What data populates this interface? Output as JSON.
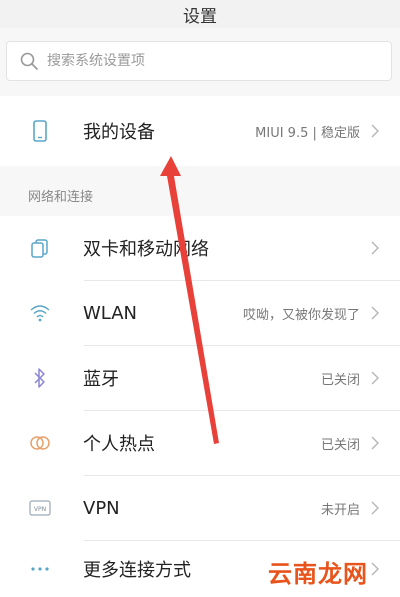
{
  "header": {
    "title": "设置"
  },
  "search": {
    "placeholder": "搜索系统设置项"
  },
  "device_row": {
    "label": "我的设备",
    "value": "MIUI 9.5 | 稳定版",
    "icon": "phone-icon"
  },
  "section": {
    "title": "网络和连接"
  },
  "network_rows": [
    {
      "label": "双卡和移动网络",
      "value": "",
      "icon": "sim-cards-icon"
    },
    {
      "label": "WLAN",
      "value": "哎呦，又被你发现了",
      "icon": "wifi-icon"
    },
    {
      "label": "蓝牙",
      "value": "已关闭",
      "icon": "bluetooth-icon"
    },
    {
      "label": "个人热点",
      "value": "已关闭",
      "icon": "hotspot-icon"
    },
    {
      "label": "VPN",
      "value": "未开启",
      "icon": "vpn-icon"
    },
    {
      "label": "更多连接方式",
      "value": "",
      "icon": "more-dots-icon"
    }
  ],
  "watermark": {
    "text": "云南龙网"
  },
  "colors": {
    "arrow": "#e8413a",
    "icon": "#5aa6c9",
    "watermark": "#e8541b"
  }
}
